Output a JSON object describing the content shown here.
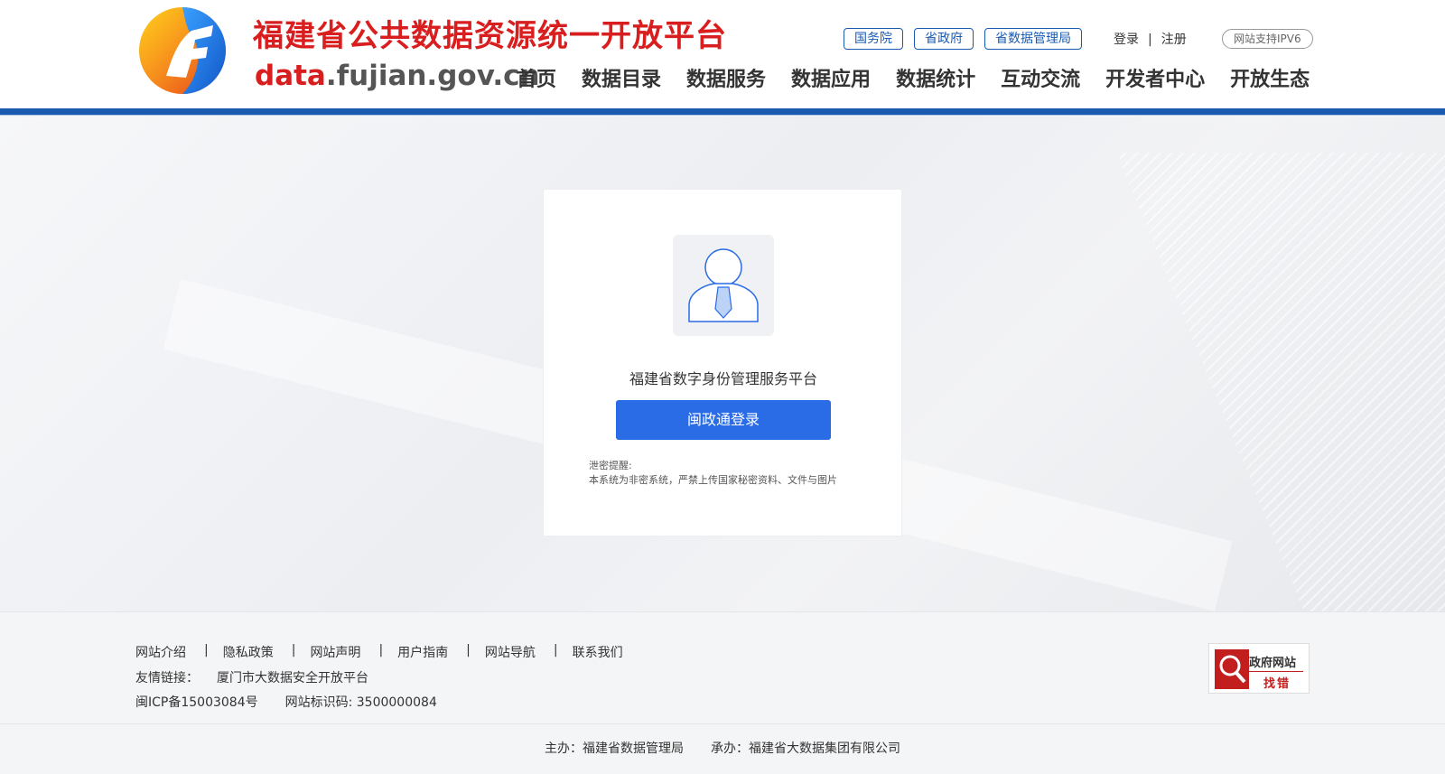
{
  "header": {
    "title": "福建省公共数据资源统一开放平台",
    "domain_accent": "data",
    "domain_rest": ".fujian.gov.cn",
    "top_links": [
      "国务院",
      "省政府",
      "省数据管理局"
    ],
    "login": "登录",
    "auth_sep": "|",
    "register": "注册",
    "ipv6": "网站支持IPV6",
    "nav": [
      "首页",
      "数据目录",
      "数据服务",
      "数据应用",
      "数据统计",
      "互动交流",
      "开发者中心",
      "开放生态"
    ],
    "brand_color": "#1a5bb0",
    "title_color": "#d81e1e"
  },
  "login_card": {
    "platform_name": "福建省数字身份管理服务平台",
    "login_button": "闽政通登录",
    "notice_title": "泄密提醒:",
    "notice_text": "本系统为非密系统，严禁上传国家秘密资料、文件与图片",
    "button_color": "#2a6be6"
  },
  "footer": {
    "links": [
      "网站介绍",
      "隐私政策",
      "网站声明",
      "用户指南",
      "网站导航",
      "联系我们"
    ],
    "link_sep": "|",
    "friend_label": "友情链接：",
    "friend_link": "厦门市大数据安全开放平台",
    "icp": "闽ICP备15003084号",
    "site_code": "网站标识码: 3500000084",
    "gov_badge_top": "政府网站",
    "gov_badge_bottom": "找错"
  },
  "bottom": {
    "sponsor": "主办：福建省数据管理局",
    "contractor": "承办：福建省大数据集团有限公司"
  }
}
